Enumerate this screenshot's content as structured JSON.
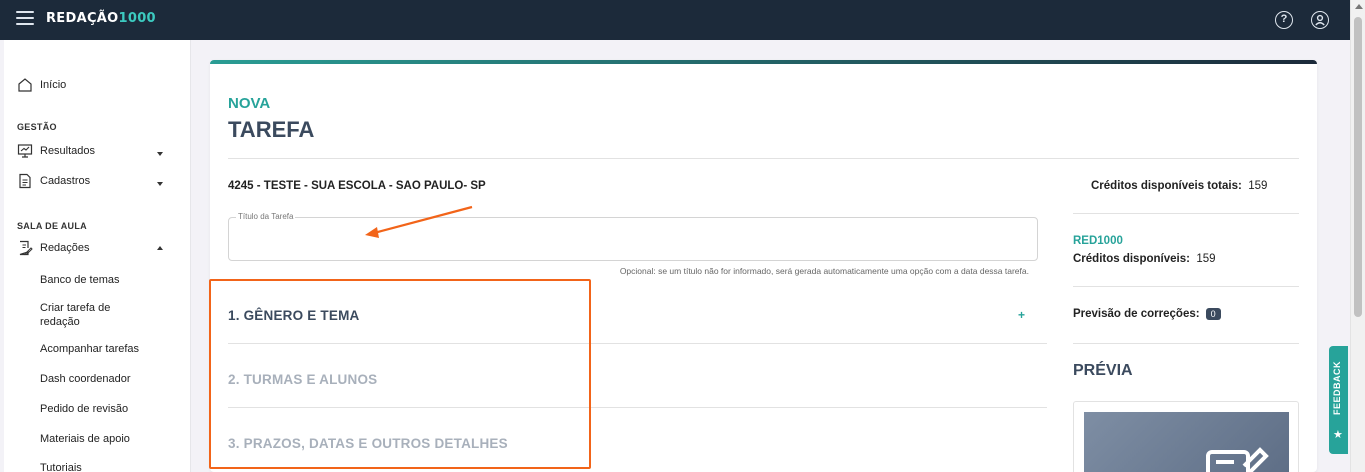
{
  "topbar": {
    "logo": "REDAÇÃO",
    "logo_accent": "1000",
    "help_icon": "help-icon",
    "user_icon": "user-icon"
  },
  "sidebar": {
    "inicio": "Início",
    "section_gestao": "GESTÃO",
    "resultados": "Resultados",
    "cadastros": "Cadastros",
    "section_sala": "SALA DE AULA",
    "redacoes": "Redações",
    "sub_items": [
      "Banco de temas",
      "Criar tarefa de redação",
      "Acompanhar tarefas",
      "Dash coordenador",
      "Pedido de revisão",
      "Materiais de apoio",
      "Tutoriais"
    ]
  },
  "main": {
    "title_top": "NOVA",
    "title_main": "TAREFA",
    "school": "4245 - TESTE - SUA ESCOLA - SAO PAULO- SP",
    "title_field_label": "Título da Tarefa",
    "title_field_value": "",
    "title_hint": "Opcional: se um título não for informado, será gerada automaticamente uma opção com a data dessa tarefa.",
    "steps": [
      "1. GÊNERO E TEMA",
      "2. TURMAS E ALUNOS",
      "3. PRAZOS, DATAS E OUTROS DETALHES"
    ],
    "expand_symbol": "+"
  },
  "right_panel": {
    "creditos_totais_label": "Créditos disponíveis totais:",
    "creditos_totais_value": "159",
    "plan_name": "RED1000",
    "creditos_label": "Créditos disponíveis:",
    "creditos_value": "159",
    "previsao_label": "Previsão de correções:",
    "previsao_value": "0",
    "previa_title": "PRÉVIA"
  },
  "feedback": {
    "label": "FEEDBACK"
  },
  "colors": {
    "topbar": "#1c2a3a",
    "accent": "#27a39a",
    "annotation": "#f26419",
    "heading": "#3b4a5e"
  }
}
